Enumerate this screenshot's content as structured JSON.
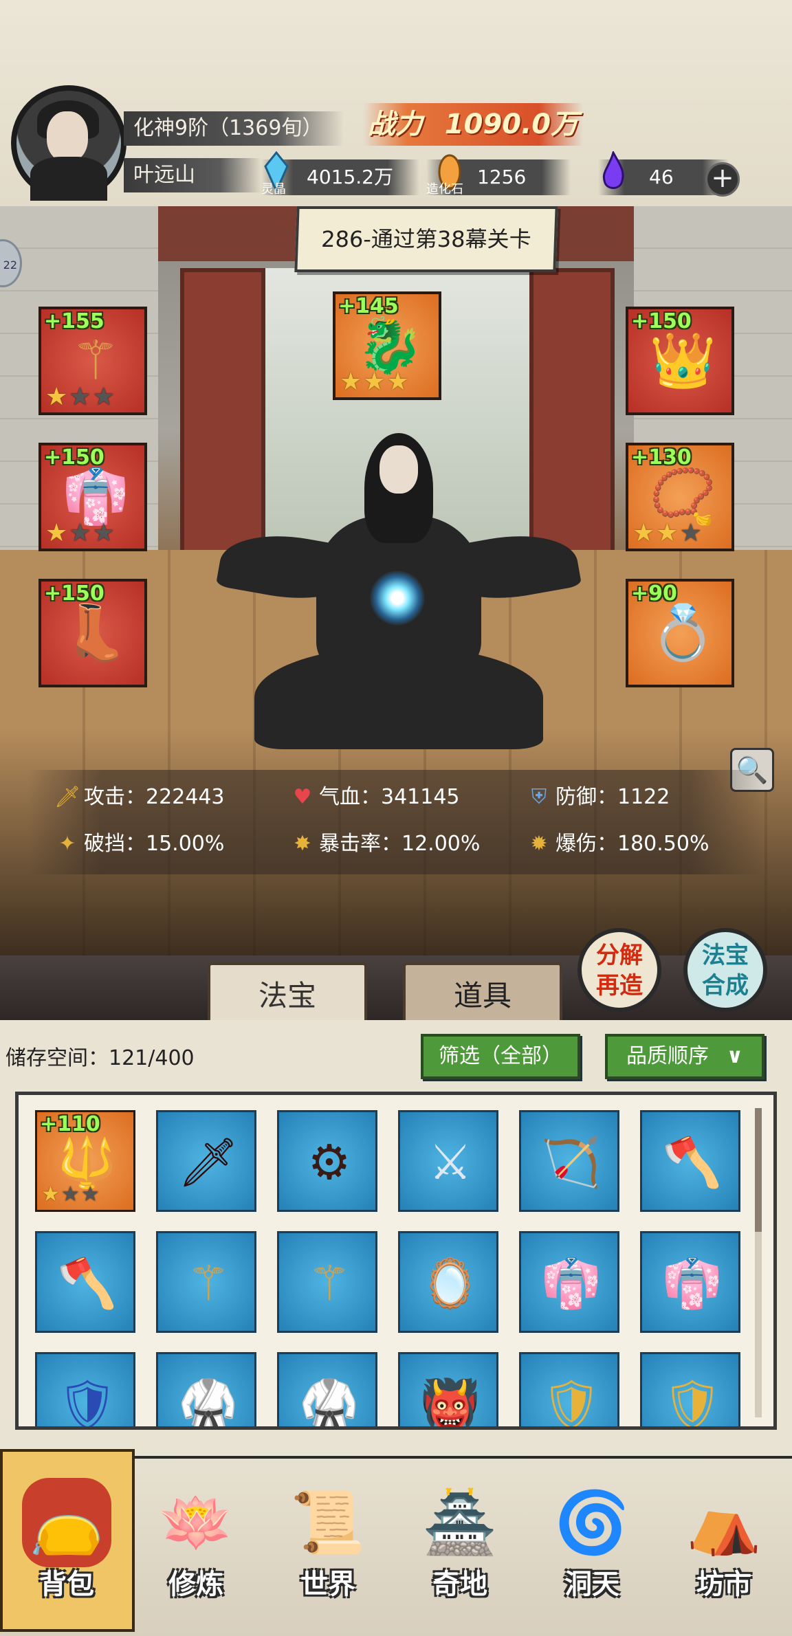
{
  "player": {
    "realm": "化神9阶（1369旬）",
    "name": "叶远山",
    "power_label": "战力",
    "power_value": "1090.0万"
  },
  "resources": [
    {
      "name": "灵晶",
      "value": "4015.2万",
      "icon": "blue-crystal-icon"
    },
    {
      "name": "造化石",
      "value": "1256",
      "icon": "orange-stone-icon"
    },
    {
      "name": "",
      "value": "46",
      "icon": "purple-flame-icon"
    }
  ],
  "side_indicator": "22",
  "stage": "286-通过第38幕关卡",
  "equipment": {
    "left": [
      {
        "level": "+155",
        "stars": 1,
        "art": "staff"
      },
      {
        "level": "+150",
        "stars": 1,
        "art": "robe"
      },
      {
        "level": "+150",
        "stars": 0,
        "art": "boots"
      }
    ],
    "top": {
      "level": "+145",
      "stars": 3,
      "art": "dragon-charm"
    },
    "right": [
      {
        "level": "+150",
        "stars": 0,
        "art": "crown"
      },
      {
        "level": "+130",
        "stars": 2,
        "art": "necklace"
      },
      {
        "level": "+90",
        "stars": 0,
        "art": "ring"
      }
    ]
  },
  "stats": {
    "attack": "攻击：222443",
    "hp": "气血：341145",
    "defense": "防御：1122",
    "pierce": "破挡：15.00%",
    "crit_rate": "暴击率：12.00%",
    "crit_dmg": "爆伤：180.50%"
  },
  "buttons": {
    "decompose": "分解再造",
    "synthesize": "法宝合成"
  },
  "tabs": [
    "法宝",
    "道具"
  ],
  "inventory": {
    "storage": "储存空间：121/400",
    "filter": "筛选（全部）",
    "sort": "品质顺序",
    "items": [
      {
        "art": "golden-bracelet",
        "level": "+110",
        "stars": 1,
        "quality": "orange"
      },
      {
        "art": "dark-blade",
        "quality": "blue"
      },
      {
        "art": "spiked-wheel",
        "quality": "blue"
      },
      {
        "art": "sword",
        "quality": "blue"
      },
      {
        "art": "bow",
        "quality": "blue"
      },
      {
        "art": "axe",
        "quality": "blue"
      },
      {
        "art": "axe",
        "quality": "blue"
      },
      {
        "art": "staff",
        "quality": "blue"
      },
      {
        "art": "staff",
        "quality": "blue"
      },
      {
        "art": "mirror",
        "quality": "blue"
      },
      {
        "art": "robe",
        "quality": "blue"
      },
      {
        "art": "robe",
        "quality": "blue"
      },
      {
        "art": "blue-armor",
        "quality": "blue"
      },
      {
        "art": "white-armor",
        "quality": "blue"
      },
      {
        "art": "white-armor",
        "quality": "blue"
      },
      {
        "art": "demon-helm",
        "quality": "blue"
      },
      {
        "art": "gold-armor",
        "quality": "blue"
      },
      {
        "art": "gold-armor",
        "quality": "blue"
      }
    ]
  },
  "nav": [
    {
      "label": "背包",
      "icon": "bag-icon"
    },
    {
      "label": "修炼",
      "icon": "lotus-icon"
    },
    {
      "label": "世界",
      "icon": "scroll-map-icon"
    },
    {
      "label": "奇地",
      "icon": "pagoda-icon"
    },
    {
      "label": "洞天",
      "icon": "portal-icon"
    },
    {
      "label": "坊市",
      "icon": "market-stall-icon"
    }
  ],
  "colors": {
    "level_text": "#9dff5a",
    "power_accent": "#d8502a",
    "filter_green": "#4e9a3a"
  }
}
